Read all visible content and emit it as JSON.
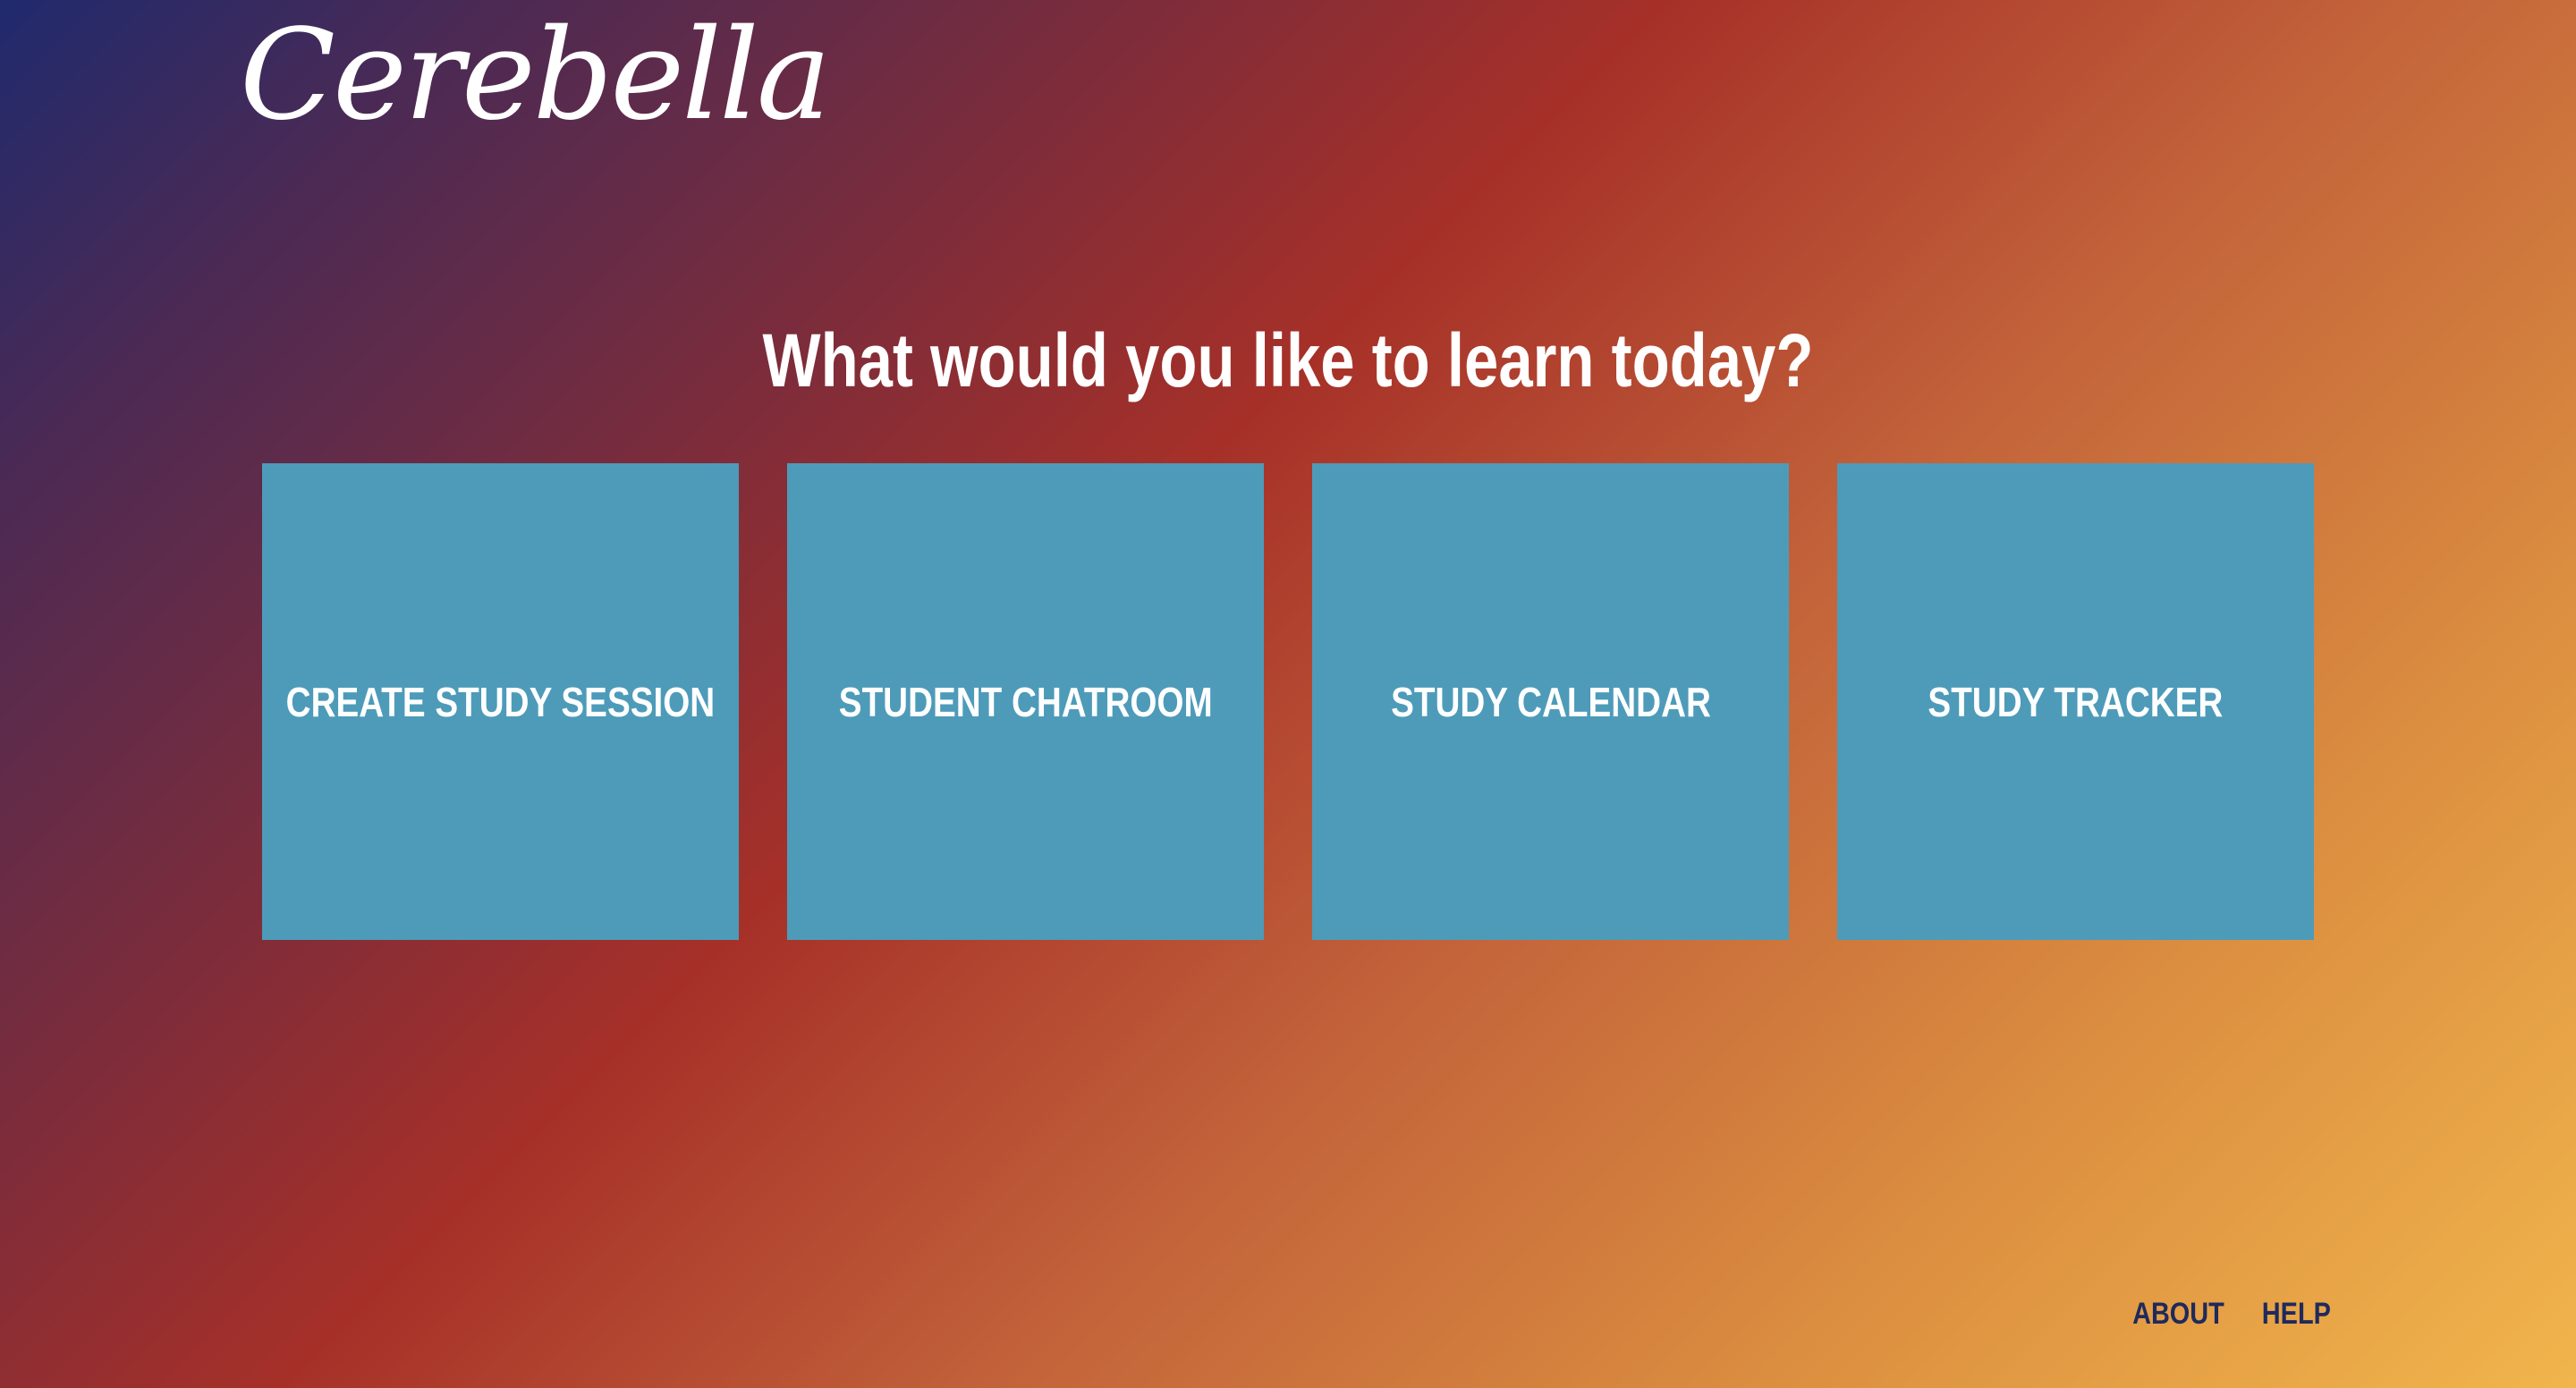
{
  "brand": {
    "logo_text": "Cerebella"
  },
  "main": {
    "headline": "What would you like to learn today?",
    "tiles": [
      {
        "label": "CREATE STUDY SESSION"
      },
      {
        "label": "STUDENT CHATROOM"
      },
      {
        "label": "STUDY CALENDAR"
      },
      {
        "label": "STUDY TRACKER"
      }
    ]
  },
  "footer": {
    "links": [
      {
        "label": "ABOUT"
      },
      {
        "label": "HELP"
      }
    ]
  },
  "colors": {
    "tile_background": "#4d9bb9",
    "gradient_start": "#1f2a6d",
    "gradient_mid": "#a63028",
    "gradient_end": "#f1b54c",
    "footer_link": "#1f2a5c"
  }
}
